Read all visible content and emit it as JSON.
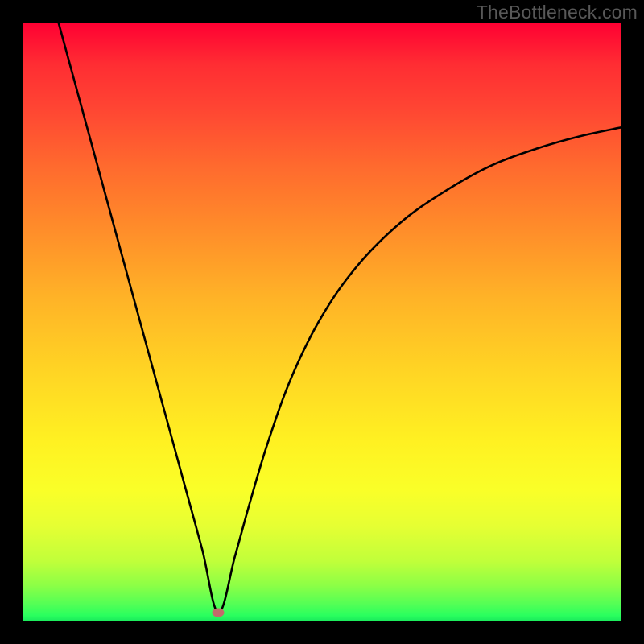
{
  "watermark": "TheBottleneck.com",
  "chart_data": {
    "type": "line",
    "title": "",
    "xlabel": "",
    "ylabel": "",
    "xlim": [
      0,
      1
    ],
    "ylim": [
      0,
      1
    ],
    "background_gradient": {
      "top": "#ff0033",
      "bottom": "#18e85c"
    },
    "min_marker": {
      "x": 0.327,
      "y": 0.985,
      "color": "#c36b6b"
    },
    "series": [
      {
        "name": "curve",
        "x": [
          0.06,
          0.09,
          0.12,
          0.15,
          0.18,
          0.21,
          0.24,
          0.27,
          0.3,
          0.327,
          0.355,
          0.38,
          0.41,
          0.45,
          0.5,
          0.56,
          0.63,
          0.7,
          0.78,
          0.86,
          0.93,
          1.0
        ],
        "values": [
          0.0,
          0.11,
          0.22,
          0.33,
          0.44,
          0.55,
          0.66,
          0.77,
          0.88,
          0.985,
          0.89,
          0.8,
          0.7,
          0.59,
          0.49,
          0.405,
          0.335,
          0.285,
          0.24,
          0.21,
          0.19,
          0.175
        ]
      }
    ]
  }
}
